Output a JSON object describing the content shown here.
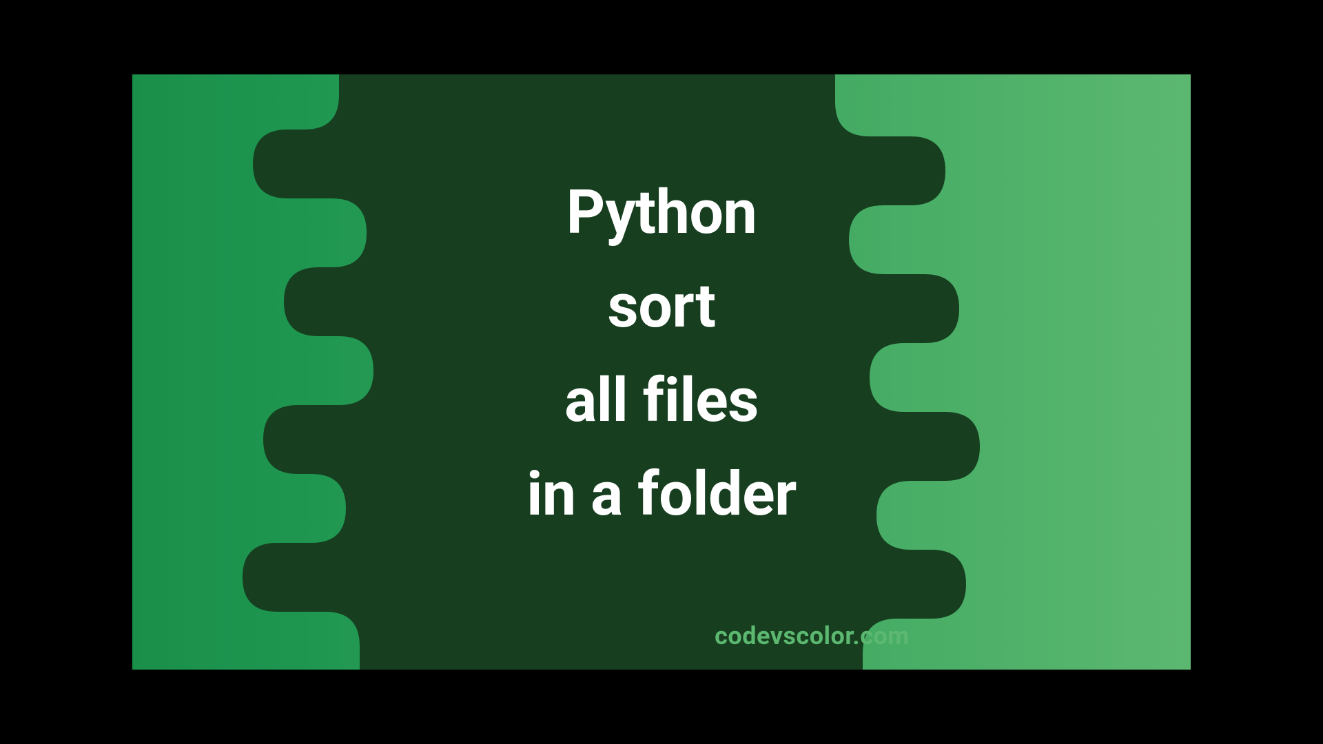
{
  "title": {
    "line1": "Python",
    "line2": "sort",
    "line3": "all files",
    "line4": "in a folder"
  },
  "watermark": "codevscolor.com",
  "colors": {
    "bg_gradient_start": "#1a8f4a",
    "bg_gradient_end": "#5cb870",
    "blob": "#163e1f",
    "text": "#ffffff",
    "watermark": "#5cb870"
  }
}
